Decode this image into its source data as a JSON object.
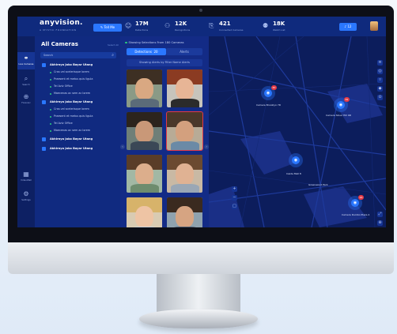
{
  "header": {
    "logo": "anyvision.",
    "tagline": "A MYSTIC FOUNDATION",
    "tellme_label": "Tell Me",
    "stats": [
      {
        "icon": "face-icon",
        "value": "17M",
        "label": "Detections"
      },
      {
        "icon": "people-icon",
        "value": "12K",
        "label": "Recognitions"
      },
      {
        "icon": "camera-icon",
        "value": "421",
        "label": "Connected Cameras"
      },
      {
        "icon": "user-x-icon",
        "value": "18K",
        "label": "Watch List"
      }
    ],
    "notif_count": "12"
  },
  "rail": [
    {
      "icon": "camera-grid-icon",
      "label": "Live Cameras",
      "active": true
    },
    {
      "icon": "search-icon",
      "label": "Search",
      "active": false
    },
    {
      "icon": "globe-icon",
      "label": "Forensic",
      "active": false
    },
    {
      "icon": "video-wall-icon",
      "label": "VideoWall",
      "active": false
    },
    {
      "icon": "gear-icon",
      "label": "Settings",
      "active": false
    }
  ],
  "cameras": {
    "title": "All Cameras",
    "select_all": "Select All",
    "search_placeholder": "Search",
    "groups": [
      {
        "name": "Akhirnya Joko Bayar Utang",
        "children": [
          "Cras vel scelerisque lorem",
          "Praesent et metus quis ligula",
          "Tel Aviv Office",
          "Maecenas ac sem ac lorem"
        ]
      },
      {
        "name": "Akhirnya Joko Bayar Utang",
        "children": [
          "Cras vel scelerisque lorem",
          "Praesent et metus quis ligula",
          "Tel Aviv Office",
          "Maecenas ac sem ac lorem"
        ]
      },
      {
        "name": "Akhirnya Joko Bayar Utang",
        "children": []
      },
      {
        "name": "Akhirnya Joko Bayar Utang",
        "children": []
      }
    ]
  },
  "selections": {
    "heading": "Showing Selections From 180 Cameras",
    "tab_detections": "Detections",
    "tab_detections_count": "20",
    "tab_alerts": "Alerts",
    "filter": "Showing Alerts by Filter Name Alerts"
  },
  "map": {
    "pins": [
      {
        "label": "Camera Brooklyn 7D",
        "count": "87"
      },
      {
        "label": "Camera Silver Hill 9D",
        "count": "81"
      },
      {
        "label": "Inside Mall 8",
        "count": ""
      },
      {
        "label": "Camera Dumbo Plaza 4",
        "count": "24"
      }
    ],
    "place_label": "Greenwood Park"
  }
}
